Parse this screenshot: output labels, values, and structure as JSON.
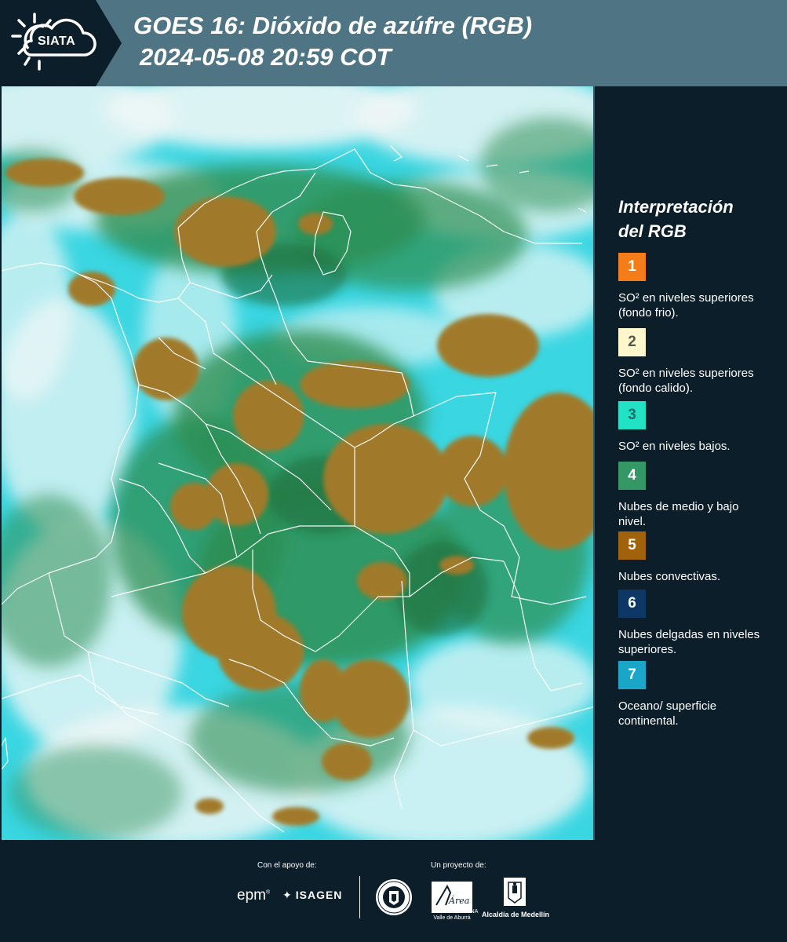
{
  "header": {
    "logo_text": "SIATA",
    "title": "GOES 16: Dióxido de azúfre (RGB)",
    "subtitle": "2024-05-08 20:59 COT"
  },
  "legend": {
    "title_line1": "Interpretación",
    "title_line2": "del RGB",
    "items": [
      {
        "number": "1",
        "color": "#f57d19",
        "text": "SO² en niveles superiores (fondo frio)."
      },
      {
        "number": "2",
        "color": "#fff7cc",
        "text": "SO² en niveles superiores (fondo calido)."
      },
      {
        "number": "3",
        "color": "#21e2c4",
        "text": "SO² en niveles bajos."
      },
      {
        "number": "4",
        "color": "#349766",
        "text": "Nubes de medio y bajo nivel."
      },
      {
        "number": "5",
        "color": "#a0630b",
        "text": "Nubes convectivas."
      },
      {
        "number": "6",
        "color": "#0d3866",
        "text": "Nubes delgadas en niveles superiores."
      },
      {
        "number": "7",
        "color": "#1aa6c8",
        "text": "Oceano/ superficie continental."
      }
    ]
  },
  "map": {
    "colors": {
      "ocean": "#3ad6e2",
      "cloud_white": "#eef6f6",
      "convective": "#a07a2a",
      "mid_low": "#2e8e52",
      "border": "#ffffff"
    }
  },
  "footer": {
    "support_label": "Con el apoyo de:",
    "project_label": "Un proyecto de:",
    "epm": "epm",
    "isagen": "ISAGEN",
    "area_label": "METROPOLITANA Valle de Aburrá",
    "area_script": "Área",
    "alcaldia_label": "Alcaldía de Medellín"
  }
}
